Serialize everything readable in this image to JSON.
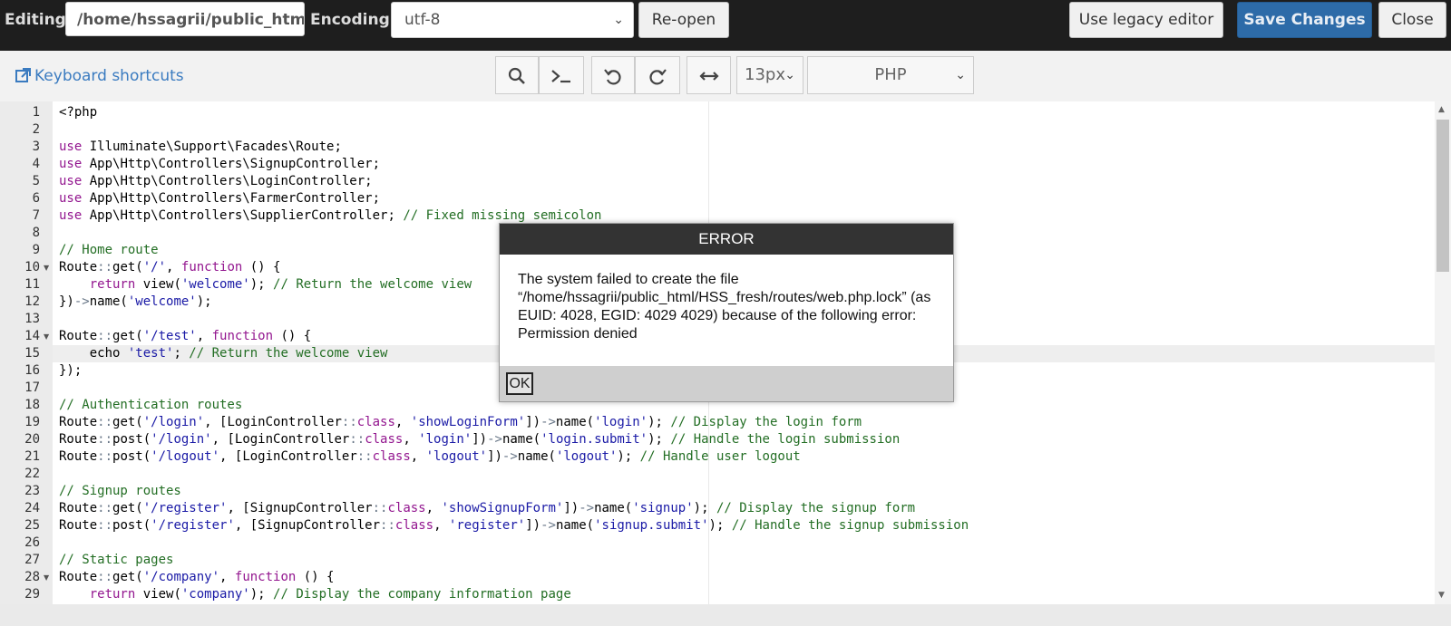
{
  "toolbar": {
    "editing_label": "Editing:",
    "editing_path": "/home/hssagrii/public_html/HSS_fresh/routes/web.php",
    "encoding_label": "Encoding:",
    "encoding_value": "utf-8",
    "reopen_label": "Re-open",
    "legacy_label": "Use legacy editor",
    "save_label": "Save Changes",
    "close_label": "Close"
  },
  "editor_toolbar": {
    "shortcuts_label": "Keyboard shortcuts",
    "font_size": "13px",
    "mode": "PHP"
  },
  "code": {
    "line_numbers": [
      "1",
      "2",
      "3",
      "4",
      "5",
      "6",
      "7",
      "8",
      "9",
      "10",
      "11",
      "12",
      "13",
      "14",
      "15",
      "16",
      "17",
      "18",
      "19",
      "20",
      "21",
      "22",
      "23",
      "24",
      "25",
      "26",
      "27",
      "28",
      "29"
    ],
    "fold_lines": [
      10,
      14,
      28
    ],
    "active_line": 15,
    "lines": [
      [
        [
          "",
          "<?php"
        ]
      ],
      [],
      [
        [
          "kw",
          "use"
        ],
        [
          "",
          " Illuminate\\Support\\Facades\\Route;"
        ]
      ],
      [
        [
          "kw",
          "use"
        ],
        [
          "",
          " App\\Http\\Controllers\\SignupController;"
        ]
      ],
      [
        [
          "kw",
          "use"
        ],
        [
          "",
          " App\\Http\\Controllers\\LoginController;"
        ]
      ],
      [
        [
          "kw",
          "use"
        ],
        [
          "",
          " App\\Http\\Controllers\\FarmerController;"
        ]
      ],
      [
        [
          "kw",
          "use"
        ],
        [
          "",
          " App\\Http\\Controllers\\SupplierController; "
        ],
        [
          "cm",
          "// Fixed missing semicolon"
        ]
      ],
      [],
      [
        [
          "cm",
          "// Home route"
        ]
      ],
      [
        [
          "",
          "Route"
        ],
        [
          "op",
          "::"
        ],
        [
          "",
          "get("
        ],
        [
          "str",
          "'/'"
        ],
        [
          "",
          ", "
        ],
        [
          "kw",
          "function"
        ],
        [
          "",
          " () {"
        ]
      ],
      [
        [
          "",
          "    "
        ],
        [
          "kw",
          "return"
        ],
        [
          "",
          " view("
        ],
        [
          "str",
          "'welcome'"
        ],
        [
          "",
          "); "
        ],
        [
          "cm",
          "// Return the welcome view"
        ]
      ],
      [
        [
          "",
          "})"
        ],
        [
          "op",
          "->"
        ],
        [
          "",
          "name("
        ],
        [
          "str",
          "'welcome'"
        ],
        [
          "",
          ");"
        ]
      ],
      [],
      [
        [
          "",
          "Route"
        ],
        [
          "op",
          "::"
        ],
        [
          "",
          "get("
        ],
        [
          "str",
          "'/test'"
        ],
        [
          "",
          ", "
        ],
        [
          "kw",
          "function"
        ],
        [
          "",
          " () {"
        ]
      ],
      [
        [
          "",
          "    echo "
        ],
        [
          "str",
          "'test'"
        ],
        [
          "",
          "; "
        ],
        [
          "cm",
          "// Return the welcome view"
        ]
      ],
      [
        [
          "",
          "});"
        ]
      ],
      [],
      [
        [
          "cm",
          "// Authentication routes"
        ]
      ],
      [
        [
          "",
          "Route"
        ],
        [
          "op",
          "::"
        ],
        [
          "",
          "get("
        ],
        [
          "str",
          "'/login'"
        ],
        [
          "",
          ", [LoginController"
        ],
        [
          "op",
          "::"
        ],
        [
          "kw",
          "class"
        ],
        [
          "",
          ", "
        ],
        [
          "str",
          "'showLoginForm'"
        ],
        [
          "",
          "])"
        ],
        [
          "op",
          "->"
        ],
        [
          "",
          "name("
        ],
        [
          "str",
          "'login'"
        ],
        [
          "",
          "); "
        ],
        [
          "cm",
          "// Display the login form"
        ]
      ],
      [
        [
          "",
          "Route"
        ],
        [
          "op",
          "::"
        ],
        [
          "",
          "post("
        ],
        [
          "str",
          "'/login'"
        ],
        [
          "",
          ", [LoginController"
        ],
        [
          "op",
          "::"
        ],
        [
          "kw",
          "class"
        ],
        [
          "",
          ", "
        ],
        [
          "str",
          "'login'"
        ],
        [
          "",
          "])"
        ],
        [
          "op",
          "->"
        ],
        [
          "",
          "name("
        ],
        [
          "str",
          "'login.submit'"
        ],
        [
          "",
          "); "
        ],
        [
          "cm",
          "// Handle the login submission"
        ]
      ],
      [
        [
          "",
          "Route"
        ],
        [
          "op",
          "::"
        ],
        [
          "",
          "post("
        ],
        [
          "str",
          "'/logout'"
        ],
        [
          "",
          ", [LoginController"
        ],
        [
          "op",
          "::"
        ],
        [
          "kw",
          "class"
        ],
        [
          "",
          ", "
        ],
        [
          "str",
          "'logout'"
        ],
        [
          "",
          "])"
        ],
        [
          "op",
          "->"
        ],
        [
          "",
          "name("
        ],
        [
          "str",
          "'logout'"
        ],
        [
          "",
          "); "
        ],
        [
          "cm",
          "// Handle user logout"
        ]
      ],
      [],
      [
        [
          "cm",
          "// Signup routes"
        ]
      ],
      [
        [
          "",
          "Route"
        ],
        [
          "op",
          "::"
        ],
        [
          "",
          "get("
        ],
        [
          "str",
          "'/register'"
        ],
        [
          "",
          ", [SignupController"
        ],
        [
          "op",
          "::"
        ],
        [
          "kw",
          "class"
        ],
        [
          "",
          ", "
        ],
        [
          "str",
          "'showSignupForm'"
        ],
        [
          "",
          "])"
        ],
        [
          "op",
          "->"
        ],
        [
          "",
          "name("
        ],
        [
          "str",
          "'signup'"
        ],
        [
          "",
          "); "
        ],
        [
          "cm",
          "// Display the signup form"
        ]
      ],
      [
        [
          "",
          "Route"
        ],
        [
          "op",
          "::"
        ],
        [
          "",
          "post("
        ],
        [
          "str",
          "'/register'"
        ],
        [
          "",
          ", [SignupController"
        ],
        [
          "op",
          "::"
        ],
        [
          "kw",
          "class"
        ],
        [
          "",
          ", "
        ],
        [
          "str",
          "'register'"
        ],
        [
          "",
          "])"
        ],
        [
          "op",
          "->"
        ],
        [
          "",
          "name("
        ],
        [
          "str",
          "'signup.submit'"
        ],
        [
          "",
          "); "
        ],
        [
          "cm",
          "// Handle the signup submission"
        ]
      ],
      [],
      [
        [
          "cm",
          "// Static pages"
        ]
      ],
      [
        [
          "",
          "Route"
        ],
        [
          "op",
          "::"
        ],
        [
          "",
          "get("
        ],
        [
          "str",
          "'/company'"
        ],
        [
          "",
          ", "
        ],
        [
          "kw",
          "function"
        ],
        [
          "",
          " () {"
        ]
      ],
      [
        [
          "",
          "    "
        ],
        [
          "kw",
          "return"
        ],
        [
          "",
          " view("
        ],
        [
          "str",
          "'company'"
        ],
        [
          "",
          "); "
        ],
        [
          "cm",
          "// Display the company information page"
        ]
      ]
    ]
  },
  "dialog": {
    "title": "ERROR",
    "message": "The system failed to create the file “/home/hssagrii/public_html/HSS_fresh/routes/web.php.lock” (as EUID: 4028, EGID: 4029 4029) because of the following error: Permission denied",
    "ok_label": "OK"
  },
  "colors": {
    "keyword": "#93168f",
    "string": "#1a1aa6",
    "comment": "#236e24",
    "primary_button": "#2d6ba8"
  }
}
